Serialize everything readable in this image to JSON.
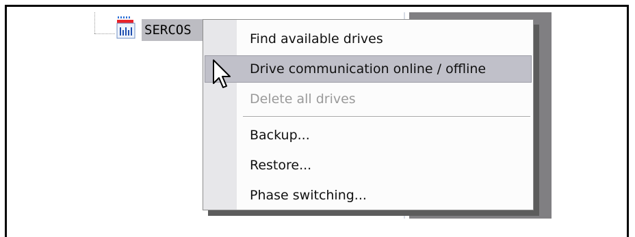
{
  "tree": {
    "node_label": "SERCOS"
  },
  "context_menu": {
    "items": [
      {
        "label": "Find available drives",
        "state": "normal"
      },
      {
        "label": "Drive communication online / offline",
        "state": "hovered"
      },
      {
        "label": "Delete all drives",
        "state": "disabled"
      },
      {
        "label": "Backup...",
        "state": "normal"
      },
      {
        "label": "Restore...",
        "state": "normal"
      },
      {
        "label": "Phase switching...",
        "state": "normal"
      }
    ]
  },
  "icons": {
    "node_icon": "sercos-bus-icon",
    "cursor": "arrow-cursor-icon"
  },
  "colors": {
    "selection": "#bcbcc2",
    "hover": "#c0c0c9",
    "panel": "#807f82",
    "gutter": "#e7e7ea"
  }
}
